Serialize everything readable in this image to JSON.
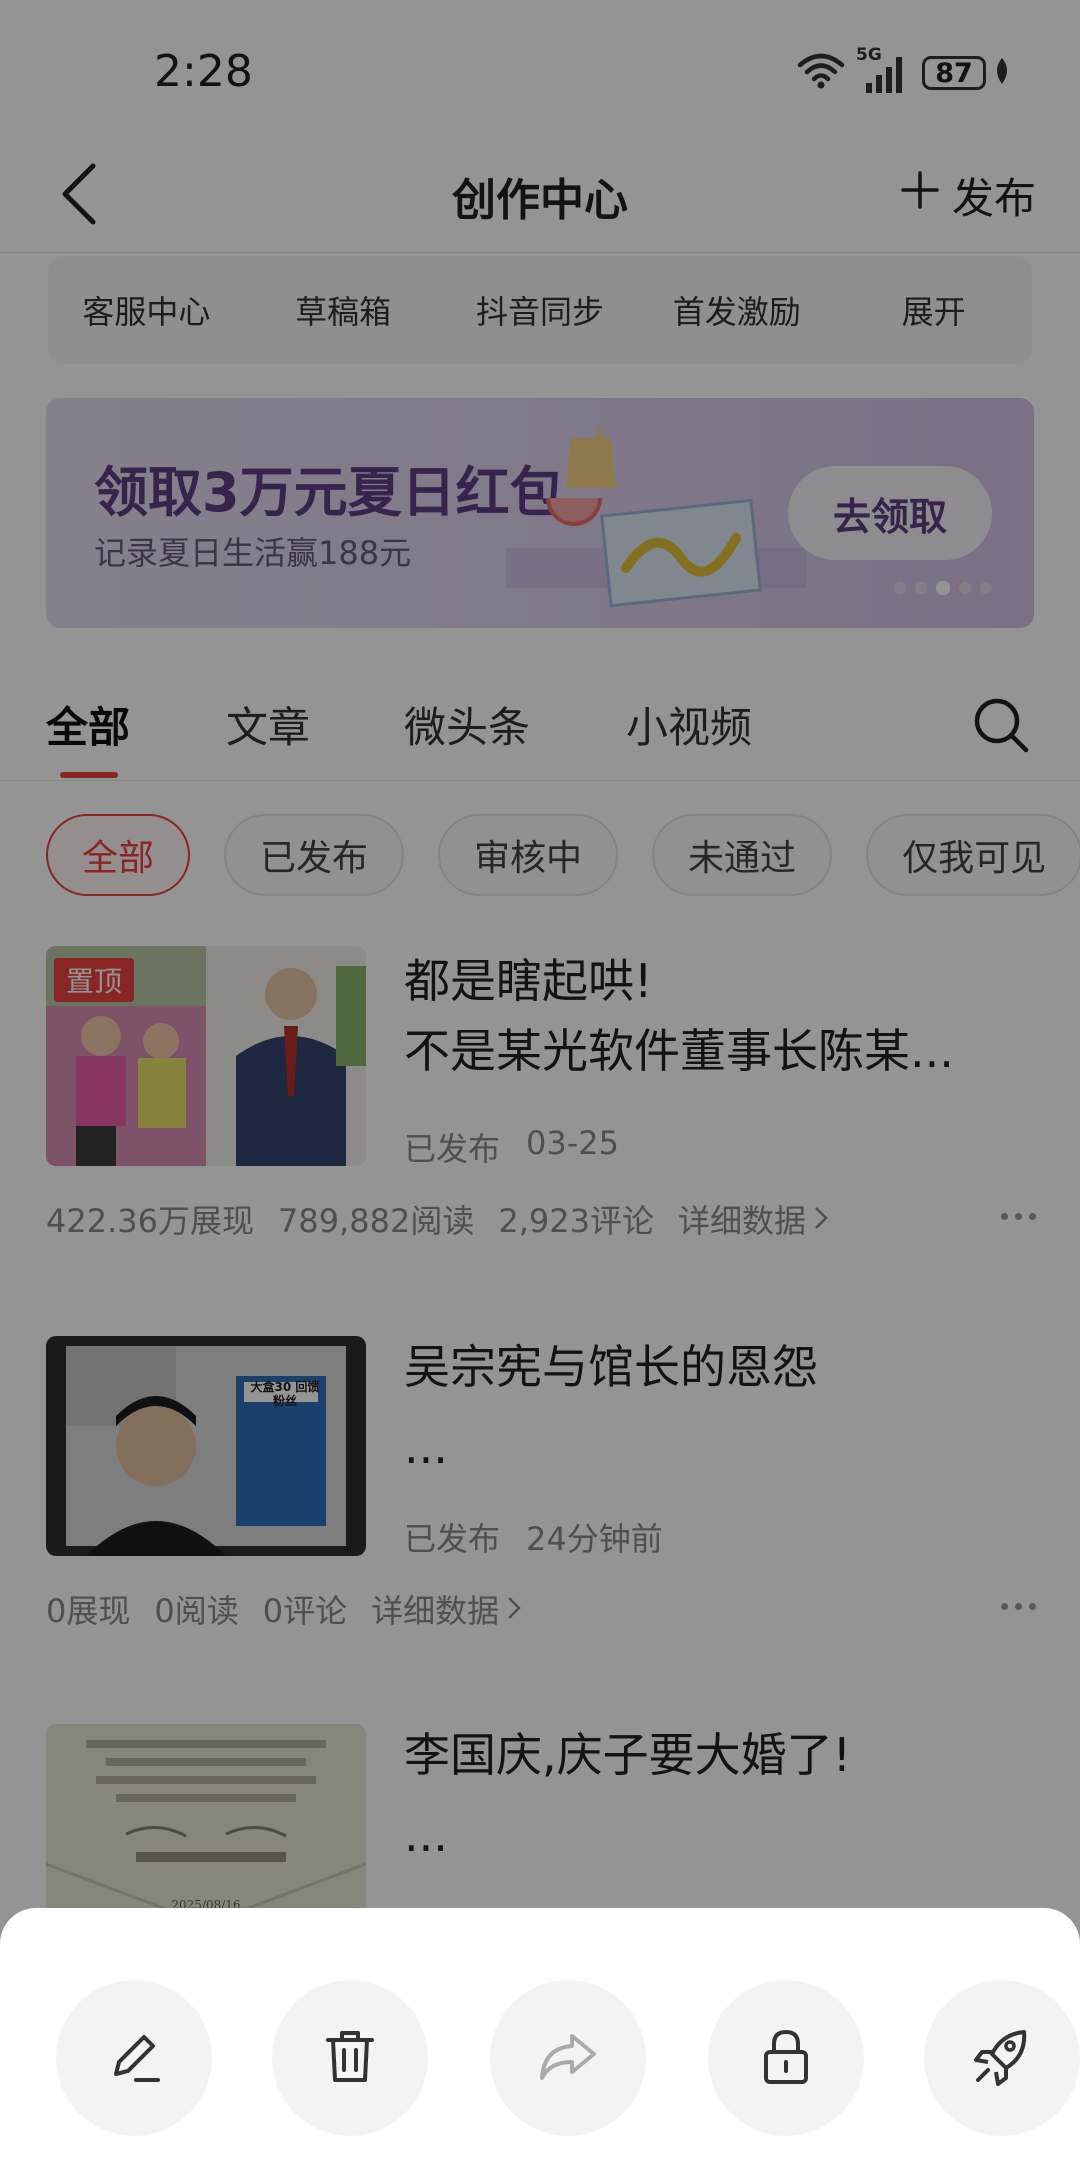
{
  "status": {
    "time": "2:28",
    "network": "5G",
    "battery": "87",
    "icons": [
      "wifi-icon",
      "signal-5g-icon",
      "battery-icon",
      "leaf-icon"
    ]
  },
  "header": {
    "title": "创作中心",
    "publish_label": "发布",
    "icons": [
      "back-arrow-icon",
      "plus-icon"
    ]
  },
  "tools": [
    "客服中心",
    "草稿箱",
    "抖音同步",
    "首发激励",
    "展开"
  ],
  "banner": {
    "title": "领取3万元夏日红包",
    "subtitle": "记录夏日生活赢188元",
    "cta": "去领取",
    "page_count": 5,
    "active_page": 3
  },
  "tabs": {
    "items": [
      "全部",
      "文章",
      "微头条",
      "小视频"
    ],
    "active": 0,
    "search_icon": "search-icon"
  },
  "filters": {
    "items": [
      "全部",
      "已发布",
      "审核中",
      "未通过",
      "仅我可见"
    ],
    "active": 0
  },
  "articles": [
    {
      "title_line1": "都是瞎起哄!",
      "title_line2": "不是某光软件董事长陈某...",
      "pinned_label": "置顶",
      "status": "已发布",
      "date": "03-25",
      "views": "422.36万展现",
      "reads": "789,882阅读",
      "comments": "2,923评论",
      "details": "详细数据"
    },
    {
      "title_line1": "吴宗宪与馆长的恩怨",
      "title_line2": "...",
      "thumb_caption": "大盒30 回馈粉丝",
      "status": "已发布",
      "date": "24分钟前",
      "views": "0展现",
      "reads": "0阅读",
      "comments": "0评论",
      "details": "详细数据"
    },
    {
      "title_line1": "李国庆,庆子要大婚了!",
      "title_line2": "...",
      "thumb_date": "2025/08/16"
    }
  ],
  "sheet": {
    "actions": [
      "edit-icon",
      "delete-icon",
      "share-icon",
      "lock-icon",
      "boost-rocket-icon"
    ]
  },
  "colors": {
    "accent": "#e8433e",
    "banner_text": "#5e3e86",
    "overlay": "rgba(0,0,0,0.42)"
  }
}
